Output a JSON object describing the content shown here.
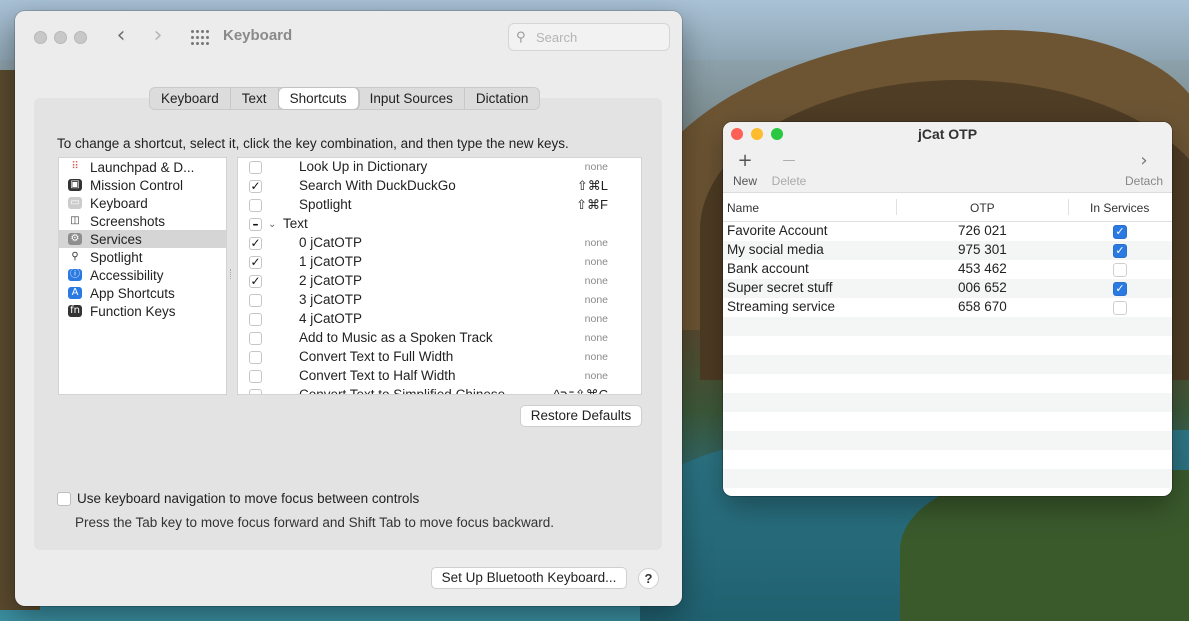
{
  "prefs": {
    "title": "Keyboard",
    "search_placeholder": "Search",
    "back_glyph": "‹",
    "forward_glyph": "›",
    "tabs": [
      "Keyboard",
      "Text",
      "Shortcuts",
      "Input Sources",
      "Dictation"
    ],
    "active_tab": "Shortcuts",
    "hint": "To change a shortcut, select it, click the key combination, and then type the new keys.",
    "categories": [
      {
        "label": "Launchpad & D...",
        "icon": "launchpad-icon"
      },
      {
        "label": "Mission Control",
        "icon": "mission-control-icon"
      },
      {
        "label": "Keyboard",
        "icon": "keyboard-icon"
      },
      {
        "label": "Screenshots",
        "icon": "screenshot-icon"
      },
      {
        "label": "Services",
        "icon": "gear-icon"
      },
      {
        "label": "Spotlight",
        "icon": "spotlight-icon"
      },
      {
        "label": "Accessibility",
        "icon": "accessibility-icon"
      },
      {
        "label": "App Shortcuts",
        "icon": "app-store-icon"
      },
      {
        "label": "Function Keys",
        "icon": "fn-icon"
      }
    ],
    "selected_category": "Services",
    "shortcuts": [
      {
        "label": "Look Up in Dictionary",
        "checked": false,
        "key": "none"
      },
      {
        "label": "Search With DuckDuckGo",
        "checked": true,
        "key": "⇧⌘L"
      },
      {
        "label": "Spotlight",
        "checked": false,
        "key": "⇧⌘F"
      },
      {
        "label": "Text",
        "checked": "mixed",
        "key": "",
        "group": true
      },
      {
        "label": "0 jCatOTP",
        "checked": true,
        "key": "none"
      },
      {
        "label": "1 jCatOTP",
        "checked": true,
        "key": "none"
      },
      {
        "label": "2 jCatOTP",
        "checked": true,
        "key": "none"
      },
      {
        "label": "3 jCatOTP",
        "checked": false,
        "key": "none"
      },
      {
        "label": "4 jCatOTP",
        "checked": false,
        "key": "none"
      },
      {
        "label": "Add to Music as a Spoken Track",
        "checked": false,
        "key": "none"
      },
      {
        "label": "Convert Text to Full Width",
        "checked": false,
        "key": "none"
      },
      {
        "label": "Convert Text to Half Width",
        "checked": false,
        "key": "none"
      },
      {
        "label": "Convert Text to Simplified Chinese",
        "checked": false,
        "key": "^⌥⇧⌘C"
      }
    ],
    "restore_defaults": "Restore Defaults",
    "keyboard_nav_label": "Use keyboard navigation to move focus between controls",
    "keyboard_nav_checked": false,
    "keyboard_nav_sub": "Press the Tab key to move focus forward and Shift Tab to move focus backward.",
    "bluetooth_button": "Set Up Bluetooth Keyboard...",
    "help_button": "?"
  },
  "jcat": {
    "title": "jCat OTP",
    "toolbar": {
      "new_label": "New",
      "new_glyph": "+",
      "delete_label": "Delete",
      "delete_glyph": "—",
      "detach_label": "Detach",
      "detach_glyph": "›"
    },
    "columns": [
      "Name",
      "OTP",
      "In Services"
    ],
    "rows": [
      {
        "name": "Favorite Account",
        "otp": "726 021",
        "in_services": true
      },
      {
        "name": "My social media",
        "otp": "975 301",
        "in_services": true
      },
      {
        "name": "Bank account",
        "otp": "453 462",
        "in_services": false
      },
      {
        "name": "Super secret stuff",
        "otp": "006 652",
        "in_services": true
      },
      {
        "name": "Streaming service",
        "otp": "658 670",
        "in_services": false
      }
    ],
    "empty_rows": 9
  },
  "colors": {
    "accent": "#2a7ae2",
    "close": "#fe5f57",
    "minimize": "#febc2e",
    "zoom": "#28c840"
  }
}
